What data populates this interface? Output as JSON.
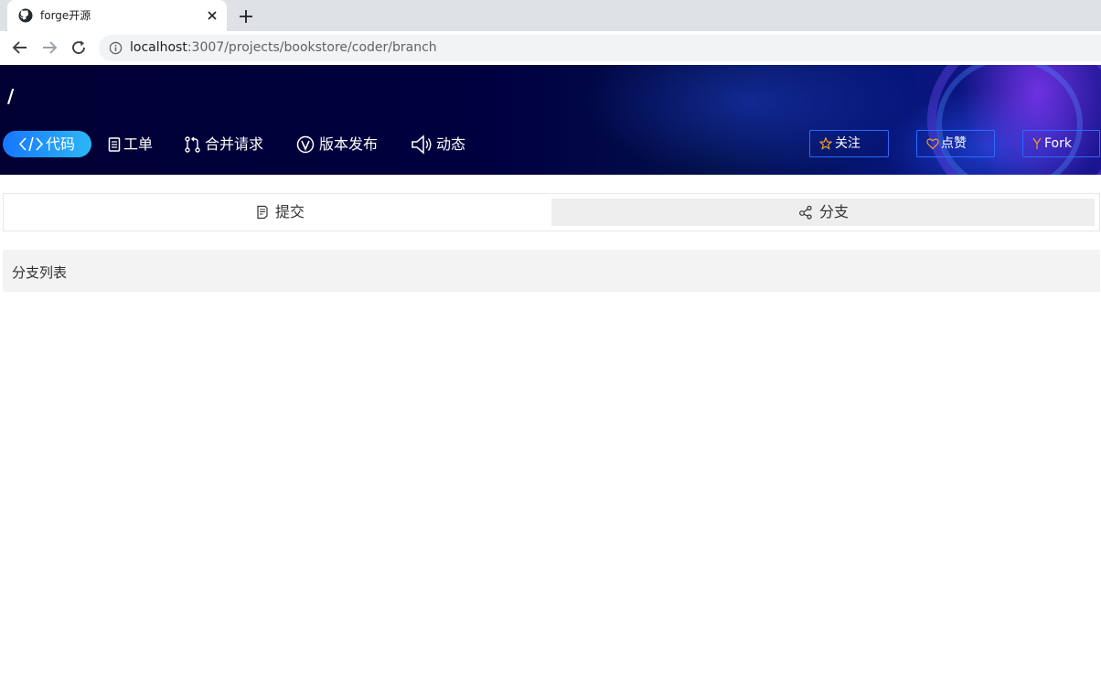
{
  "browser": {
    "tab_title": "forge开源",
    "url_host": "localhost",
    "url_path": ":3007/projects/bookstore/coder/branch"
  },
  "project": {
    "path": "/"
  },
  "nav": {
    "items": [
      {
        "label": "代码",
        "icon": "code-icon",
        "active": true
      },
      {
        "label": "工单",
        "icon": "document-icon"
      },
      {
        "label": "合并请求",
        "icon": "merge-request-icon"
      },
      {
        "label": "版本发布",
        "icon": "version-icon"
      },
      {
        "label": "动态",
        "icon": "speaker-icon"
      }
    ]
  },
  "actions": {
    "watch_label": "关注",
    "like_label": "点赞",
    "fork_label": "Fork"
  },
  "tabs": {
    "commit_label": "提交",
    "branch_label": "分支",
    "active": "branch"
  },
  "section": {
    "title": "分支列表"
  },
  "colors": {
    "accent": "#1677ff",
    "banner_bg": "#000033",
    "action_border": "#2a6bff",
    "star_color": "#f0a020"
  }
}
